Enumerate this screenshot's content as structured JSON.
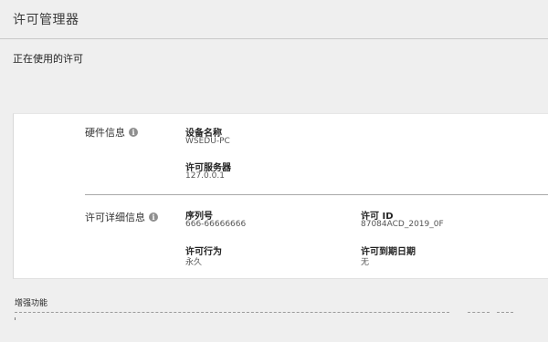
{
  "window": {
    "title": "许可管理器"
  },
  "in_use_section": {
    "heading": "正在使用的许可"
  },
  "hardware": {
    "label": "硬件信息",
    "device_name_label": "设备名称",
    "device_name_value": "WSEDU-PC",
    "license_server_label": "许可服务器",
    "license_server_value": "127.0.0.1"
  },
  "license_details": {
    "label": "许可详细信息",
    "serial_label": "序列号",
    "serial_value": "666-66666666",
    "license_id_label": "许可 ID",
    "license_id_value": "87084ACD_2019_0F",
    "behavior_label": "许可行为",
    "behavior_value": "永久",
    "expiry_label": "许可到期日期",
    "expiry_value": "无"
  },
  "enhancements": {
    "heading": "增强功能"
  },
  "icons": {
    "info": "info-icon",
    "info_glyph": "i"
  }
}
